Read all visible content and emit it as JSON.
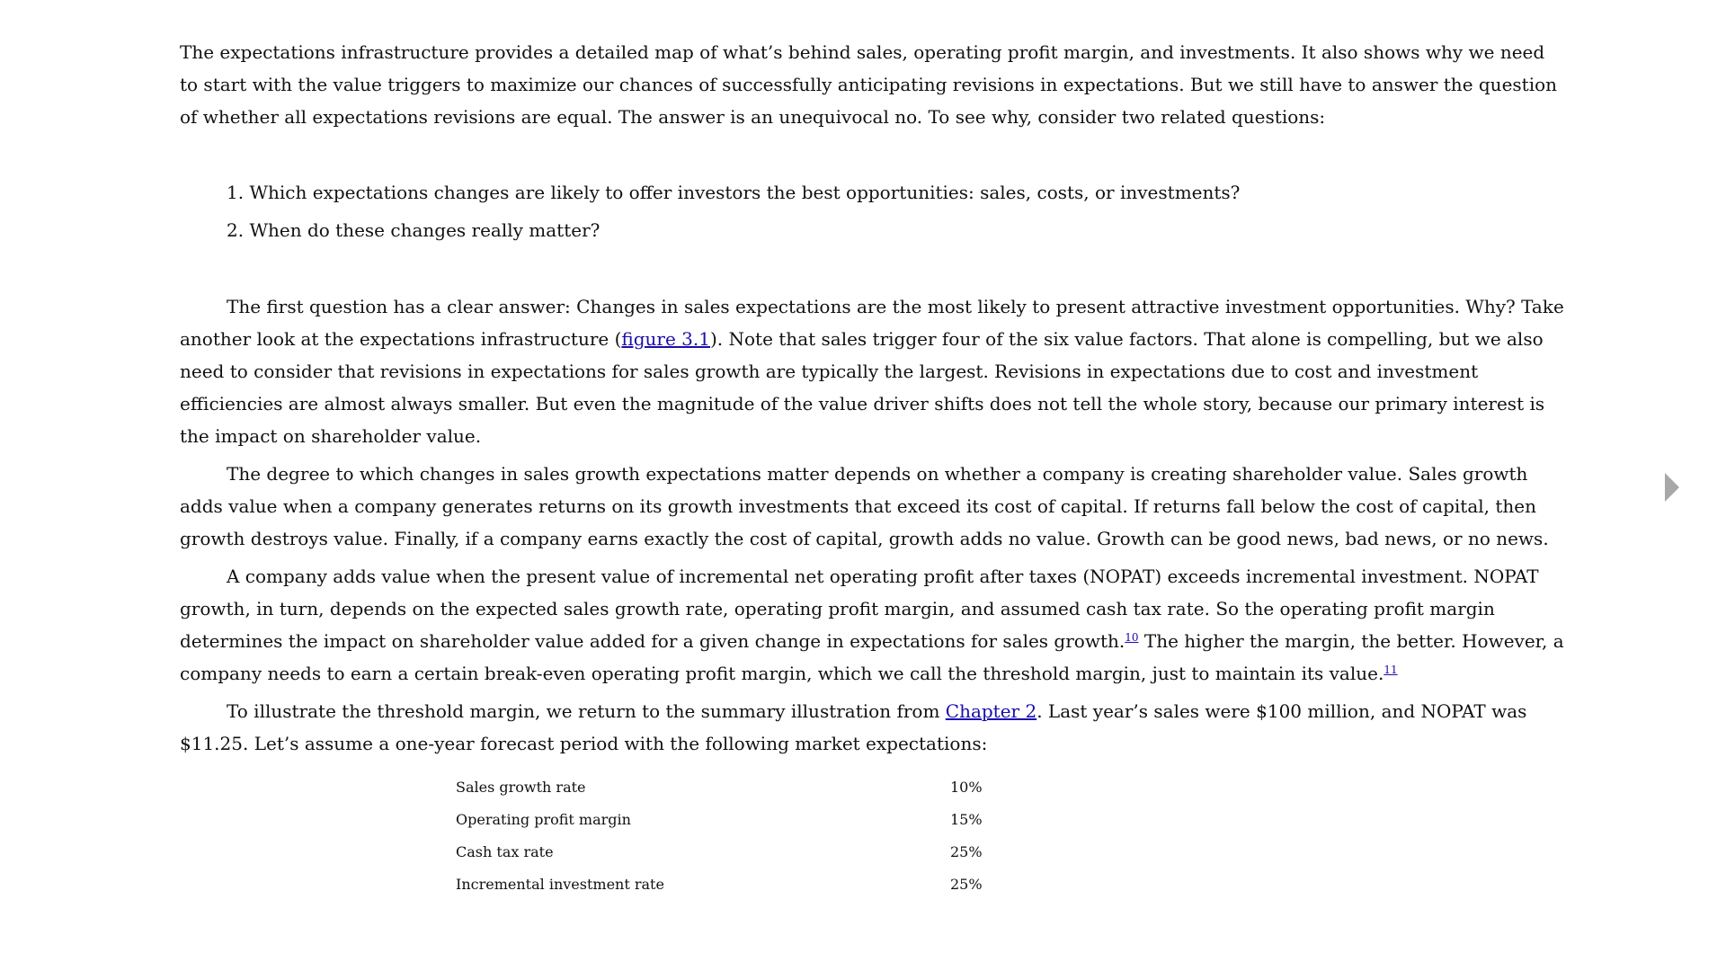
{
  "intro_paragraph": "The expectations infrastructure provides a detailed map of what’s behind sales, operating profit margin, and investments. It also shows why we need to start with the value triggers to maximize our chances of successfully anticipating revisions in expectations. But we still have to answer the question of whether all expectations revisions are equal. The answer is an unequivocal no. To see why, consider two related questions:",
  "questions": [
    {
      "number": "1.",
      "text": "Which expectations changes are likely to offer investors the best opportunities: sales, costs, or investments?"
    },
    {
      "number": "2.",
      "text": "When do these changes really matter?"
    }
  ],
  "para1": {
    "before": "The first question has a clear answer: Changes in sales expectations are the most likely to present attractive investment opportunities. Why? Take another look at the expectations infrastructure (",
    "link": "figure 3.1",
    "after": "). Note that sales trigger four of the six value factors. That alone is compelling, but we also need to consider that revisions in expectations for sales growth are typically the largest. Revisions in expectations due to cost and investment efficiencies are almost always smaller. But even the magnitude of the value driver shifts does not tell the whole story, because our primary interest is the impact on shareholder value."
  },
  "para2": "The degree to which changes in sales growth expectations matter depends on whether a company is creating shareholder value. Sales growth adds value when a company generates returns on its growth investments that exceed its cost of capital. If returns fall below the cost of capital, then growth destroys value. Finally, if a company earns exactly the cost of capital, growth adds no value. Growth can be good news, bad news, or no news.",
  "para3": {
    "before": "A company adds value when the present value of incremental net operating profit after taxes (NOPAT) exceeds incremental investment. NOPAT growth, in turn, depends on the expected sales growth rate, operating profit margin, and assumed cash tax rate. So the operating profit margin determines the impact on shareholder value added for a given change in expectations for sales growth.",
    "footnote1": "10",
    "middle": " The higher the margin, the better. However, a company needs to earn a certain break-even operating profit margin, which we call the threshold margin, just to maintain its value.",
    "footnote2": "11"
  },
  "para4": {
    "before": "To illustrate the threshold margin, we return to the summary illustration from ",
    "link": "Chapter 2",
    "after": ". Last year’s sales were $100 million, and NOPAT was $11.25. Let’s assume a one-year forecast period with the following market expectations:"
  },
  "expectations_table": [
    {
      "label": "Sales growth rate",
      "value": "10%"
    },
    {
      "label": "Operating profit margin",
      "value": "15%"
    },
    {
      "label": "Cash tax rate",
      "value": "25%"
    },
    {
      "label": "Incremental investment rate",
      "value": "25%"
    }
  ],
  "link_color": "#1a0dab",
  "next_page_icon": "next-page-arrow"
}
